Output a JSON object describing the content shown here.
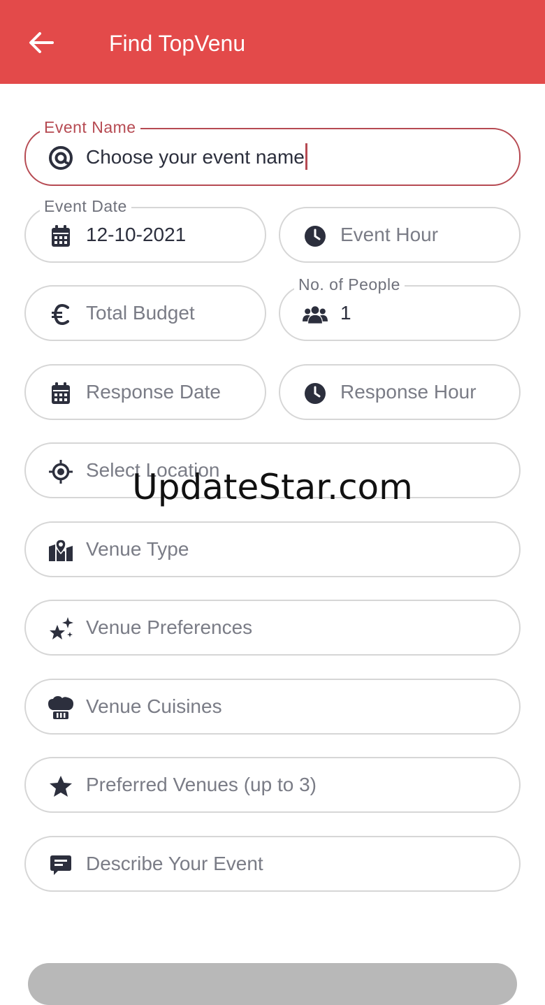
{
  "appbar": {
    "title": "Find TopVenu",
    "background_color": "#e34a4a"
  },
  "form": {
    "event_name": {
      "label": "Event Name",
      "value": "Choose your event name",
      "icon": "at-target-icon"
    },
    "event_date": {
      "label": "Event Date",
      "value": "12-10-2021",
      "icon": "calendar-icon"
    },
    "event_hour": {
      "placeholder": "Event Hour",
      "icon": "clock-icon"
    },
    "total_budget": {
      "placeholder": "Total Budget",
      "icon": "euro-icon"
    },
    "no_of_people": {
      "label": "No. of People",
      "value": "1",
      "icon": "users-icon"
    },
    "response_date": {
      "placeholder": "Response Date",
      "icon": "calendar-icon"
    },
    "response_hour": {
      "placeholder": "Response Hour",
      "icon": "clock-icon"
    },
    "location": {
      "placeholder": "Select Location",
      "icon": "crosshair-icon"
    },
    "venue_type": {
      "placeholder": "Venue Type",
      "icon": "map-pin-icon"
    },
    "venue_preferences": {
      "placeholder": "Venue Preferences",
      "icon": "sparkle-stars-icon"
    },
    "venue_cuisines": {
      "placeholder": "Venue Cuisines",
      "icon": "chef-hat-icon"
    },
    "preferred_venues": {
      "placeholder": "Preferred Venues (up to 3)",
      "icon": "star-icon"
    },
    "describe_event": {
      "placeholder": "Describe Your Event",
      "icon": "comment-icon"
    }
  },
  "watermark": "UpdateStar.com",
  "colors": {
    "accent": "#b64a52",
    "icon": "#2c2f3d",
    "border": "#d6d6d6"
  }
}
